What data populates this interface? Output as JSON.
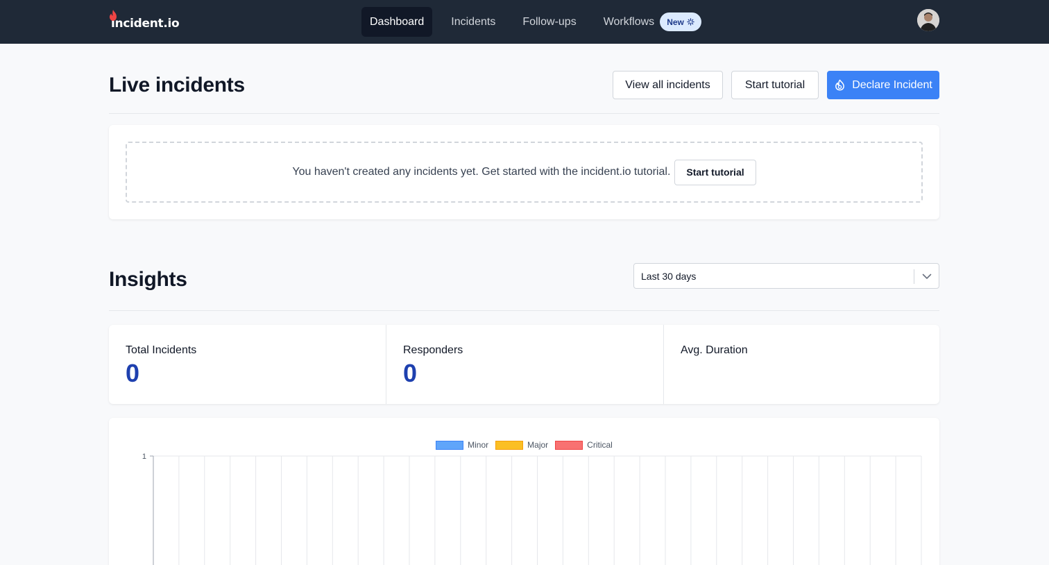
{
  "brand": {
    "name": "incident.io",
    "flame_color": "#ef4444"
  },
  "nav": {
    "items": [
      {
        "label": "Dashboard",
        "active": true
      },
      {
        "label": "Incidents"
      },
      {
        "label": "Follow-ups"
      },
      {
        "label": "Workflows",
        "badge": "New"
      }
    ]
  },
  "live": {
    "title": "Live incidents",
    "view_all_label": "View all incidents",
    "tutorial_label": "Start tutorial",
    "declare_label": "Declare Incident",
    "empty_text": "You haven't created any incidents yet. Get started with the incident.io tutorial.",
    "empty_button": "Start tutorial"
  },
  "insights": {
    "title": "Insights",
    "range": "Last 30 days",
    "stats": [
      {
        "label": "Total Incidents",
        "value": "0"
      },
      {
        "label": "Responders",
        "value": "0"
      },
      {
        "label": "Avg. Duration",
        "value": ""
      }
    ]
  },
  "colors": {
    "accent": "#3b82f6",
    "nav_bg": "#1f2937",
    "stat_value": "#1e40af"
  },
  "chart_data": {
    "type": "bar",
    "stacked": true,
    "categories_count": 30,
    "ylim": [
      0,
      1
    ],
    "y_ticks": [
      "1"
    ],
    "legend": "top-center",
    "grid": true,
    "series": [
      {
        "name": "Minor",
        "color": "#60a5fa",
        "values": [
          0,
          0,
          0,
          0,
          0,
          0,
          0,
          0,
          0,
          0,
          0,
          0,
          0,
          0,
          0,
          0,
          0,
          0,
          0,
          0,
          0,
          0,
          0,
          0,
          0,
          0,
          0,
          0,
          0,
          0
        ]
      },
      {
        "name": "Major",
        "color": "#fbbf24",
        "values": [
          0,
          0,
          0,
          0,
          0,
          0,
          0,
          0,
          0,
          0,
          0,
          0,
          0,
          0,
          0,
          0,
          0,
          0,
          0,
          0,
          0,
          0,
          0,
          0,
          0,
          0,
          0,
          0,
          0,
          0
        ]
      },
      {
        "name": "Critical",
        "color": "#f87171",
        "values": [
          0,
          0,
          0,
          0,
          0,
          0,
          0,
          0,
          0,
          0,
          0,
          0,
          0,
          0,
          0,
          0,
          0,
          0,
          0,
          0,
          0,
          0,
          0,
          0,
          0,
          0,
          0,
          0,
          0,
          0
        ]
      }
    ]
  }
}
